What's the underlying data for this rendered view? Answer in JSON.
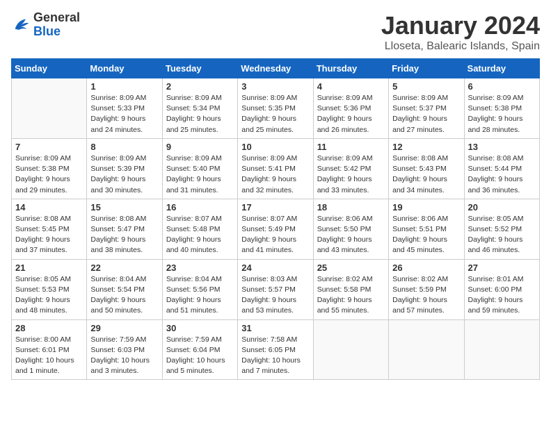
{
  "header": {
    "logo_general": "General",
    "logo_blue": "Blue",
    "month": "January 2024",
    "location": "Lloseta, Balearic Islands, Spain"
  },
  "weekdays": [
    "Sunday",
    "Monday",
    "Tuesday",
    "Wednesday",
    "Thursday",
    "Friday",
    "Saturday"
  ],
  "weeks": [
    [
      {
        "day": "",
        "info": ""
      },
      {
        "day": "1",
        "info": "Sunrise: 8:09 AM\nSunset: 5:33 PM\nDaylight: 9 hours\nand 24 minutes."
      },
      {
        "day": "2",
        "info": "Sunrise: 8:09 AM\nSunset: 5:34 PM\nDaylight: 9 hours\nand 25 minutes."
      },
      {
        "day": "3",
        "info": "Sunrise: 8:09 AM\nSunset: 5:35 PM\nDaylight: 9 hours\nand 25 minutes."
      },
      {
        "day": "4",
        "info": "Sunrise: 8:09 AM\nSunset: 5:36 PM\nDaylight: 9 hours\nand 26 minutes."
      },
      {
        "day": "5",
        "info": "Sunrise: 8:09 AM\nSunset: 5:37 PM\nDaylight: 9 hours\nand 27 minutes."
      },
      {
        "day": "6",
        "info": "Sunrise: 8:09 AM\nSunset: 5:38 PM\nDaylight: 9 hours\nand 28 minutes."
      }
    ],
    [
      {
        "day": "7",
        "info": "Sunrise: 8:09 AM\nSunset: 5:38 PM\nDaylight: 9 hours\nand 29 minutes."
      },
      {
        "day": "8",
        "info": "Sunrise: 8:09 AM\nSunset: 5:39 PM\nDaylight: 9 hours\nand 30 minutes."
      },
      {
        "day": "9",
        "info": "Sunrise: 8:09 AM\nSunset: 5:40 PM\nDaylight: 9 hours\nand 31 minutes."
      },
      {
        "day": "10",
        "info": "Sunrise: 8:09 AM\nSunset: 5:41 PM\nDaylight: 9 hours\nand 32 minutes."
      },
      {
        "day": "11",
        "info": "Sunrise: 8:09 AM\nSunset: 5:42 PM\nDaylight: 9 hours\nand 33 minutes."
      },
      {
        "day": "12",
        "info": "Sunrise: 8:08 AM\nSunset: 5:43 PM\nDaylight: 9 hours\nand 34 minutes."
      },
      {
        "day": "13",
        "info": "Sunrise: 8:08 AM\nSunset: 5:44 PM\nDaylight: 9 hours\nand 36 minutes."
      }
    ],
    [
      {
        "day": "14",
        "info": "Sunrise: 8:08 AM\nSunset: 5:45 PM\nDaylight: 9 hours\nand 37 minutes."
      },
      {
        "day": "15",
        "info": "Sunrise: 8:08 AM\nSunset: 5:47 PM\nDaylight: 9 hours\nand 38 minutes."
      },
      {
        "day": "16",
        "info": "Sunrise: 8:07 AM\nSunset: 5:48 PM\nDaylight: 9 hours\nand 40 minutes."
      },
      {
        "day": "17",
        "info": "Sunrise: 8:07 AM\nSunset: 5:49 PM\nDaylight: 9 hours\nand 41 minutes."
      },
      {
        "day": "18",
        "info": "Sunrise: 8:06 AM\nSunset: 5:50 PM\nDaylight: 9 hours\nand 43 minutes."
      },
      {
        "day": "19",
        "info": "Sunrise: 8:06 AM\nSunset: 5:51 PM\nDaylight: 9 hours\nand 45 minutes."
      },
      {
        "day": "20",
        "info": "Sunrise: 8:05 AM\nSunset: 5:52 PM\nDaylight: 9 hours\nand 46 minutes."
      }
    ],
    [
      {
        "day": "21",
        "info": "Sunrise: 8:05 AM\nSunset: 5:53 PM\nDaylight: 9 hours\nand 48 minutes."
      },
      {
        "day": "22",
        "info": "Sunrise: 8:04 AM\nSunset: 5:54 PM\nDaylight: 9 hours\nand 50 minutes."
      },
      {
        "day": "23",
        "info": "Sunrise: 8:04 AM\nSunset: 5:56 PM\nDaylight: 9 hours\nand 51 minutes."
      },
      {
        "day": "24",
        "info": "Sunrise: 8:03 AM\nSunset: 5:57 PM\nDaylight: 9 hours\nand 53 minutes."
      },
      {
        "day": "25",
        "info": "Sunrise: 8:02 AM\nSunset: 5:58 PM\nDaylight: 9 hours\nand 55 minutes."
      },
      {
        "day": "26",
        "info": "Sunrise: 8:02 AM\nSunset: 5:59 PM\nDaylight: 9 hours\nand 57 minutes."
      },
      {
        "day": "27",
        "info": "Sunrise: 8:01 AM\nSunset: 6:00 PM\nDaylight: 9 hours\nand 59 minutes."
      }
    ],
    [
      {
        "day": "28",
        "info": "Sunrise: 8:00 AM\nSunset: 6:01 PM\nDaylight: 10 hours\nand 1 minute."
      },
      {
        "day": "29",
        "info": "Sunrise: 7:59 AM\nSunset: 6:03 PM\nDaylight: 10 hours\nand 3 minutes."
      },
      {
        "day": "30",
        "info": "Sunrise: 7:59 AM\nSunset: 6:04 PM\nDaylight: 10 hours\nand 5 minutes."
      },
      {
        "day": "31",
        "info": "Sunrise: 7:58 AM\nSunset: 6:05 PM\nDaylight: 10 hours\nand 7 minutes."
      },
      {
        "day": "",
        "info": ""
      },
      {
        "day": "",
        "info": ""
      },
      {
        "day": "",
        "info": ""
      }
    ]
  ]
}
